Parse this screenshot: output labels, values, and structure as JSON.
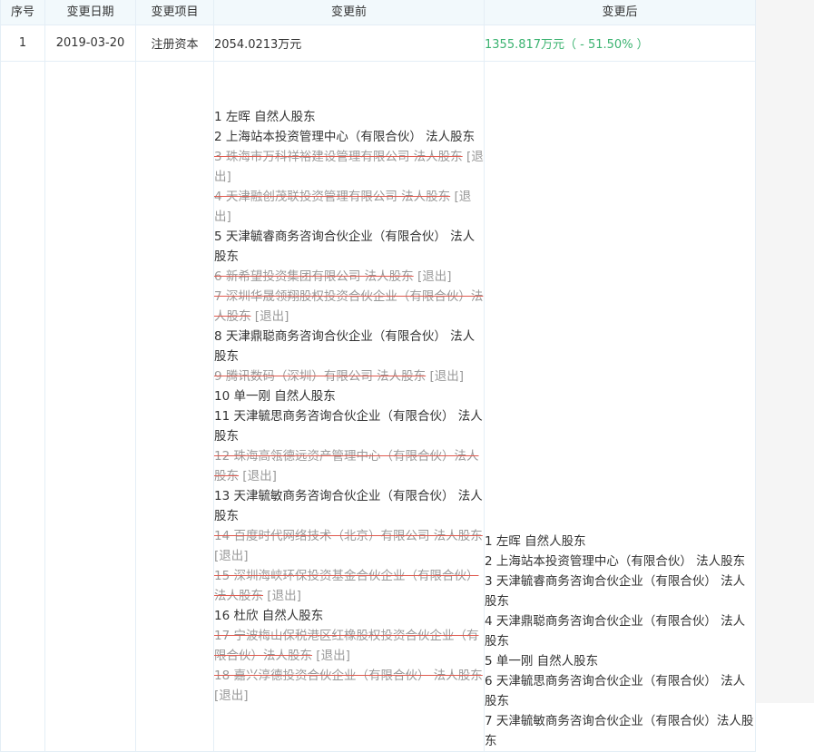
{
  "headers": {
    "index": "序号",
    "date": "变更日期",
    "item": "变更项目",
    "before": "变更前",
    "after": "变更后"
  },
  "row1": {
    "index": "1",
    "date": "2019-03-20",
    "item": "注册资本",
    "before": "2054.0213万元",
    "after": "1355.817万元（ - 51.50% ）",
    "after_color": "#3cb371"
  },
  "row2": {
    "before": [
      {
        "text": "1 左晖 自然人股东",
        "exited": false
      },
      {
        "text": "2 上海站本投资管理中心（有限合伙） 法人股东",
        "exited": false
      },
      {
        "text": "3 珠海市万科祥裕建设管理有限公司 法人股东",
        "exited": true
      },
      {
        "text": "4 天津融创茂联投资管理有限公司 法人股东",
        "exited": true
      },
      {
        "text": "5 天津毓睿商务咨询合伙企业（有限合伙） 法人股东",
        "exited": false
      },
      {
        "text": "6 新希望投资集团有限公司 法人股东",
        "exited": true
      },
      {
        "text": "7 深圳华晟领翔股权投资合伙企业（有限合伙）法人股东",
        "exited": true
      },
      {
        "text": "8 天津鼎聪商务咨询合伙企业（有限合伙） 法人股东",
        "exited": false
      },
      {
        "text": "9 腾讯数码（深圳）有限公司 法人股东",
        "exited": true
      },
      {
        "text": "10 单一刚 自然人股东",
        "exited": false
      },
      {
        "text": "11 天津毓思商务咨询合伙企业（有限合伙） 法人股东",
        "exited": false
      },
      {
        "text": "12 珠海高瓴德远资产管理中心（有限合伙）法人股东",
        "exited": true
      },
      {
        "text": "13 天津毓敏商务咨询合伙企业（有限合伙） 法人股东",
        "exited": false
      },
      {
        "text": "14 百度时代网络技术（北京）有限公司 法人股东",
        "exited": true
      },
      {
        "text": "15 深圳海峡环保投资基金合伙企业（有限合伙）法人股东",
        "exited": true
      },
      {
        "text": "16 杜欣 自然人股东",
        "exited": false
      },
      {
        "text": "17 宁波梅山保税港区红橡股权投资合伙企业（有限合伙）法人股东",
        "exited": true
      },
      {
        "text": "18 嘉兴淳德投资合伙企业（有限合伙） 法人股东",
        "exited": true
      }
    ],
    "after": [
      "1 左晖 自然人股东",
      "2 上海站本投资管理中心（有限合伙） 法人股东",
      "3 天津毓睿商务咨询合伙企业（有限合伙） 法人股东",
      "4 天津鼎聪商务咨询合伙企业（有限合伙） 法人股东",
      "5 单一刚 自然人股东",
      "6 天津毓思商务咨询合伙企业（有限合伙） 法人股东",
      "7 天津毓敏商务咨询合伙企业（有限合伙）法人股东"
    ],
    "exit_tag": "[退出]"
  }
}
